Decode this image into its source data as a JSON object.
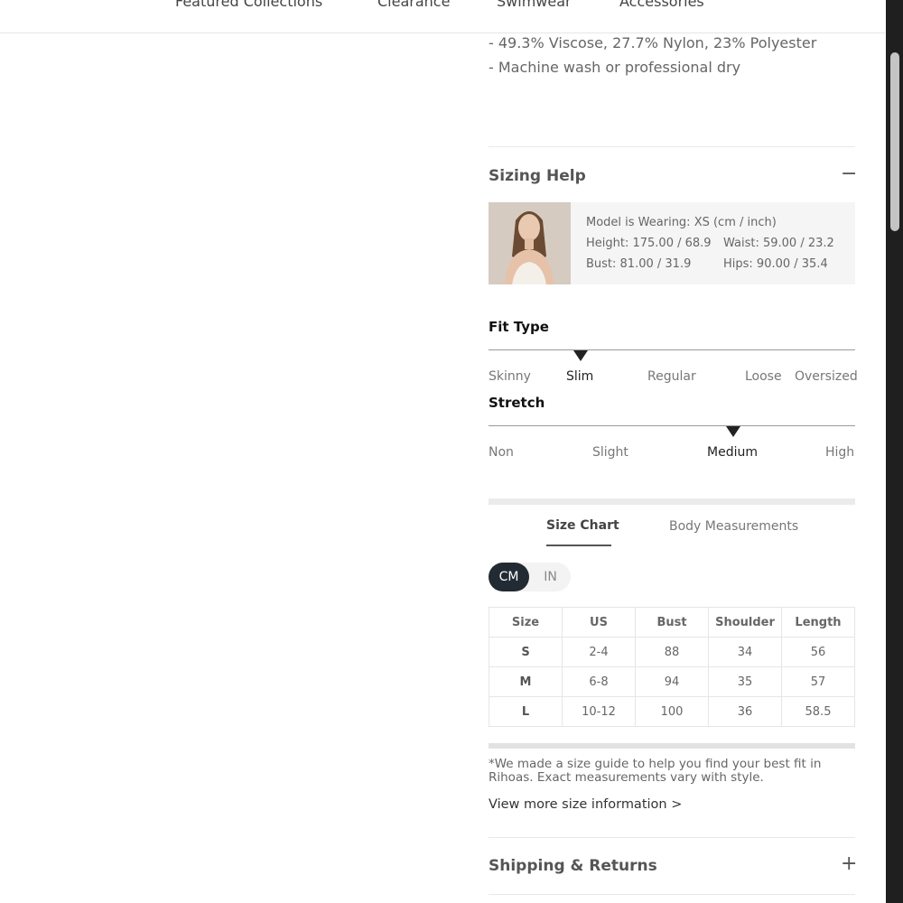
{
  "nav": {
    "items": [
      "Featured Collections",
      "Clearance",
      "Swimwear",
      "Accessories"
    ]
  },
  "product": {
    "material": "- 49.3% Viscose, 27.7% Nylon, 23% Polyester",
    "care": "- Machine wash or professional dry"
  },
  "sizing_help": {
    "title": "Sizing Help",
    "collapse_icon": "minus-icon",
    "model_wearing": "Model is Wearing: XS (cm / inch)",
    "height": "Height: 175.00 / 68.9",
    "waist": "Waist: 59.00 / 23.2",
    "bust": "Bust: 81.00 / 31.9",
    "hips": "Hips: 90.00 / 35.4"
  },
  "fit_type": {
    "title": "Fit Type",
    "options": [
      "Skinny",
      "Slim",
      "Regular",
      "Loose",
      "Oversized"
    ],
    "selected": "Slim"
  },
  "stretch": {
    "title": "Stretch",
    "options": [
      "Non",
      "Slight",
      "Medium",
      "High"
    ],
    "selected": "Medium"
  },
  "size_tabs": {
    "size_chart": "Size Chart",
    "body_measurements": "Body Measurements",
    "active": "Size Chart"
  },
  "units": {
    "cm": "CM",
    "in": "IN",
    "active": "CM"
  },
  "size_table": {
    "headers": [
      "Size",
      "US",
      "Bust",
      "Shoulder",
      "Length"
    ],
    "rows": [
      [
        "S",
        "2-4",
        "88",
        "34",
        "56"
      ],
      [
        "M",
        "6-8",
        "94",
        "35",
        "57"
      ],
      [
        "L",
        "10-12",
        "100",
        "36",
        "58.5"
      ]
    ]
  },
  "size_note": "*We made a size guide to help you find your best fit in Rihoas. Exact measurements vary with style.",
  "size_link": "View more size information >",
  "shipping": {
    "title": "Shipping & Returns",
    "expand_icon": "plus-icon"
  },
  "colors": {
    "accent_dark": "#222a33",
    "text": "#555555"
  }
}
